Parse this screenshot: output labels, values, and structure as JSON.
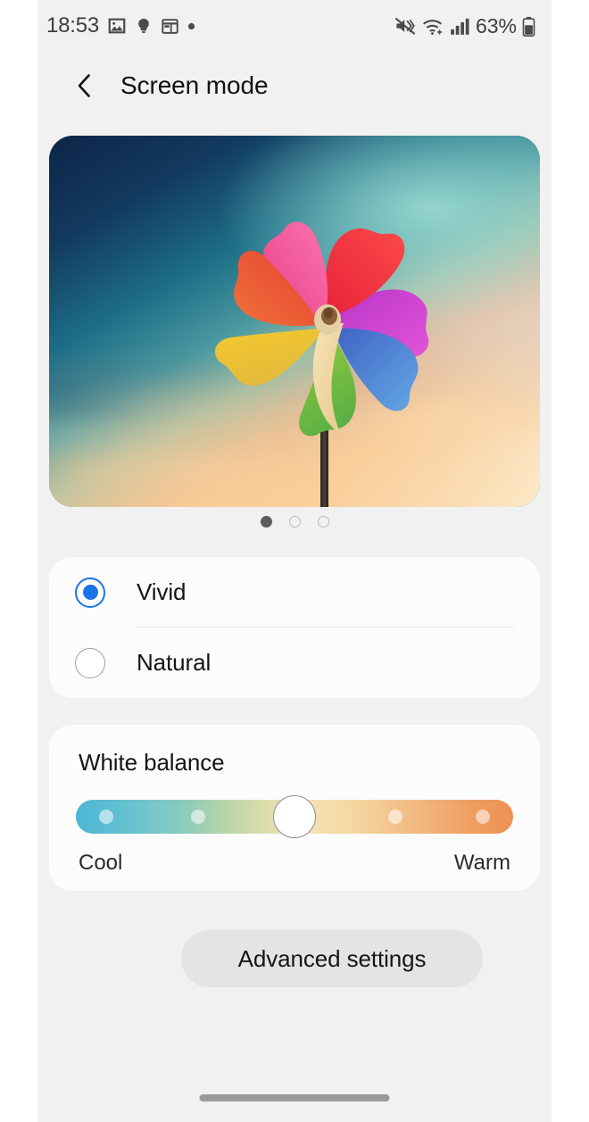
{
  "status_bar": {
    "time": "18:53",
    "battery_percent": "63%",
    "left_icons": [
      "gallery-icon",
      "lightbulb-icon",
      "calendar-widget-icon",
      "dot-icon"
    ],
    "right_icons": [
      "mute-vibrate-icon",
      "wifi-icon",
      "signal-bars-icon",
      "battery-icon"
    ]
  },
  "header": {
    "back_label": "back-chevron",
    "title": "Screen mode"
  },
  "preview": {
    "alt": "Colorful pinwheel against sunset sky",
    "pager": {
      "total": 3,
      "current": 1
    }
  },
  "modes": {
    "options": [
      {
        "label": "Vivid",
        "selected": true
      },
      {
        "label": "Natural",
        "selected": false
      }
    ]
  },
  "white_balance": {
    "title": "White balance",
    "cool_label": "Cool",
    "warm_label": "Warm",
    "value_percent": 50,
    "tick_positions": [
      7,
      28,
      73,
      93
    ],
    "gradient_from": "#4cb6d4",
    "gradient_to": "#ee9155"
  },
  "advanced": {
    "label": "Advanced settings"
  },
  "colors": {
    "background": "#f1f1f1",
    "card": "#fcfcfc",
    "accent": "#1a73e8",
    "button_bg": "#e4e4e4",
    "text_primary": "#151515"
  }
}
